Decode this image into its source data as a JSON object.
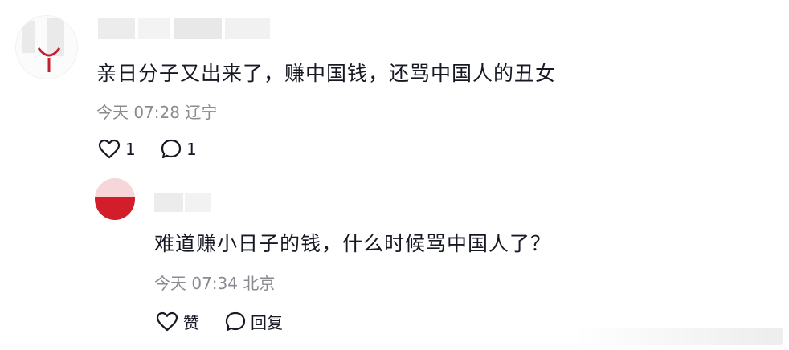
{
  "comments": [
    {
      "text": "亲日分子又出来了，赚中国钱，还骂中国人的丑女",
      "time": "今天 07:28",
      "location": "辽宁",
      "like_count": "1",
      "reply_count": "1"
    }
  ],
  "reply": {
    "text": "难道赚小日子的钱，什么时候骂中国人了？",
    "time": "今天 07:34",
    "location": "北京",
    "like_label": "赞",
    "reply_label": "回复"
  },
  "icons": {
    "like": "heart-outline-icon",
    "reply": "speech-bubble-icon"
  },
  "colors": {
    "meta_text": "#8a8b91",
    "avatar_red": "#d21e2b"
  }
}
